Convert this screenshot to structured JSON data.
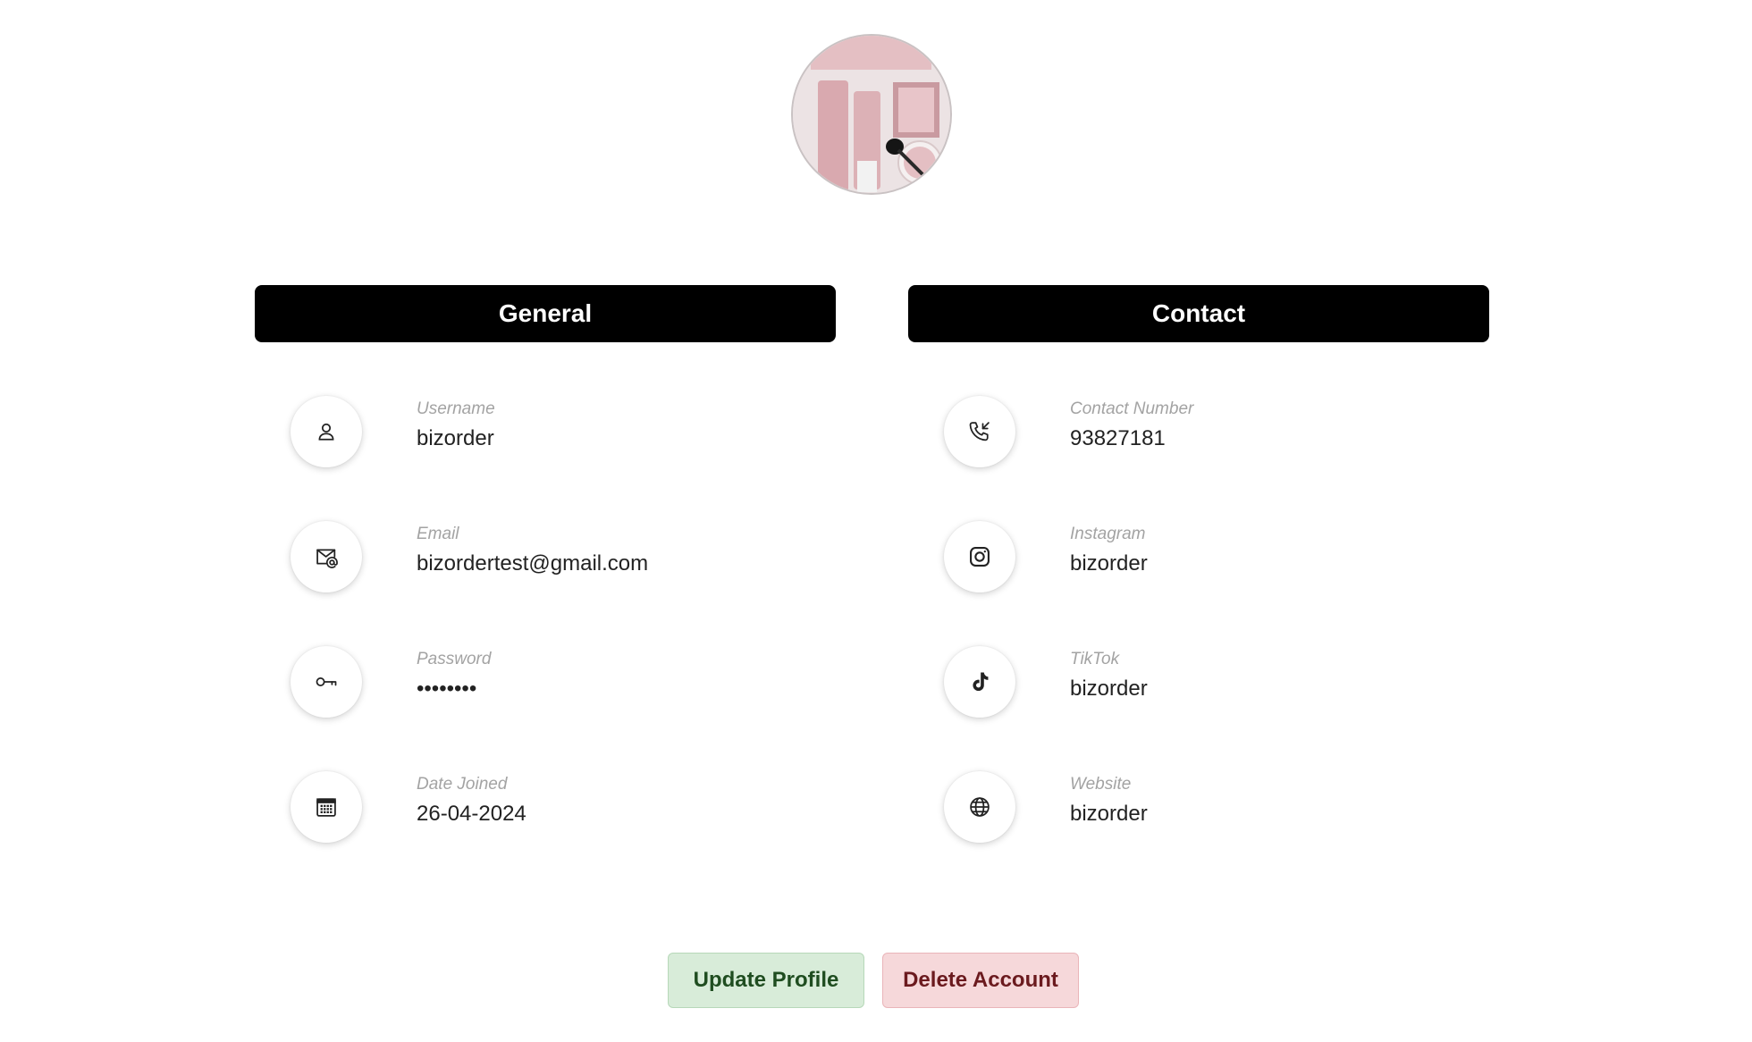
{
  "avatar": {
    "alt": "profile picture"
  },
  "general": {
    "header": "General",
    "fields": [
      {
        "label": "Username",
        "value": "bizorder",
        "icon": "user-icon"
      },
      {
        "label": "Email",
        "value": "bizordertest@gmail.com",
        "icon": "email-icon"
      },
      {
        "label": "Password",
        "value": "••••••••",
        "icon": "key-icon"
      },
      {
        "label": "Date Joined",
        "value": "26-04-2024",
        "icon": "calendar-icon"
      }
    ]
  },
  "contact": {
    "header": "Contact",
    "fields": [
      {
        "label": "Contact Number",
        "value": "93827181",
        "icon": "phone-icon"
      },
      {
        "label": "Instagram",
        "value": "bizorder",
        "icon": "instagram-icon"
      },
      {
        "label": "TikTok",
        "value": "bizorder",
        "icon": "tiktok-icon"
      },
      {
        "label": "Website",
        "value": "bizorder",
        "icon": "globe-icon"
      }
    ]
  },
  "actions": {
    "update_label": "Update Profile",
    "delete_label": "Delete Account"
  },
  "colors": {
    "header_bg": "#000000",
    "update_bg": "#d8ecd9",
    "update_text": "#1f4d20",
    "delete_bg": "#f6d8da",
    "delete_text": "#6b1a1e"
  }
}
